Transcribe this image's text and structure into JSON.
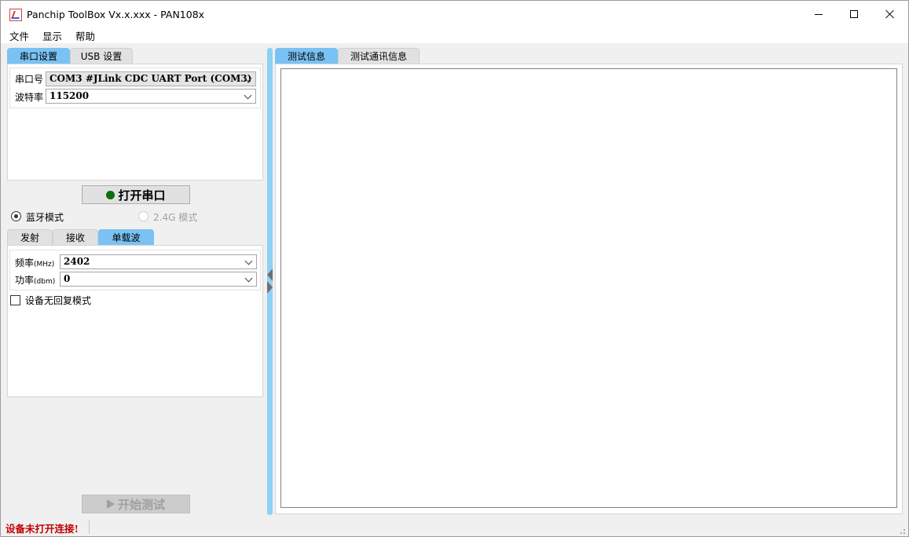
{
  "window": {
    "title": "Panchip ToolBox Vx.x.xxx  - PAN108x",
    "minimize_icon": "minimize-icon",
    "maximize_icon": "maximize-icon",
    "close_icon": "close-icon"
  },
  "menu": {
    "items": [
      "文件",
      "显示",
      "帮助"
    ]
  },
  "left": {
    "conn_tabs": [
      "串口设置",
      "USB 设置"
    ],
    "serial": {
      "port_label": "串口号",
      "port_value": "COM3 #JLink CDC UART Port (COM3)",
      "baud_label": "波特率",
      "baud_value": "115200"
    },
    "open_button": "打开串口",
    "modes": {
      "bluetooth": "蓝牙模式",
      "g24": "2.4G 模式"
    },
    "test_tabs": [
      "发射",
      "接收",
      "单载波"
    ],
    "carrier": {
      "freq_label": "频率",
      "freq_unit": "(MHz)",
      "freq_value": "2402",
      "power_label": "功率",
      "power_unit": "(dbm)",
      "power_value": "0",
      "no_reply_label": "设备无回复模式"
    },
    "start_button": "开始测试"
  },
  "right": {
    "tabs": [
      "测试信息",
      "测试通讯信息"
    ]
  },
  "status": {
    "text": "设备未打开连接!"
  },
  "colors": {
    "tab_active": "#7ac2f3",
    "splitter": "#8dd2f4",
    "status_error": "#c00000",
    "connected_dot": "#0a6e0a"
  }
}
